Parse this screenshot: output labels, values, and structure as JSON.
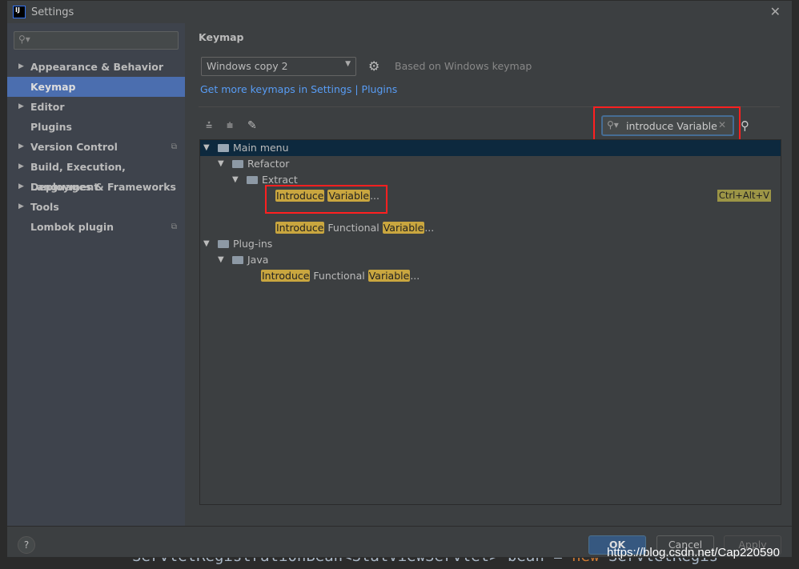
{
  "background_code": {
    "text": "ServletRegistrationBean<StatViewServlet> bean = ",
    "keyword": "new",
    "rest": " ServletRegis"
  },
  "window": {
    "title": "Settings",
    "logo": "IJ",
    "close_icon": "close-icon"
  },
  "sidebar": {
    "search_placeholder": "",
    "items": [
      {
        "label": "Appearance & Behavior",
        "expandable": true
      },
      {
        "label": "Keymap",
        "selected": true
      },
      {
        "label": "Editor",
        "expandable": true
      },
      {
        "label": "Plugins"
      },
      {
        "label": "Version Control",
        "expandable": true,
        "project_icon": true
      },
      {
        "label": "Build, Execution, Deployment",
        "expandable": true
      },
      {
        "label": "Languages & Frameworks",
        "expandable": true
      },
      {
        "label": "Tools",
        "expandable": true
      },
      {
        "label": "Lombok plugin",
        "project_icon": true
      }
    ]
  },
  "main": {
    "heading": "Keymap",
    "keymap_select": "Windows copy 2",
    "based_on": "Based on Windows keymap",
    "link_text": "Get more keymaps in Settings | Plugins",
    "search_value": "introduce Variable",
    "tree": {
      "main_menu": "Main menu",
      "refactor": "Refactor",
      "extract": "Extract",
      "item1": {
        "w1": "Introduce",
        "w2": "Variable",
        "suffix": "...",
        "shortcut": "Ctrl+Alt+V"
      },
      "item2": {
        "w1": "Introduce",
        "mid": " Functional ",
        "w2": "Variable",
        "suffix": "..."
      },
      "plugins": "Plug-ins",
      "java": "Java",
      "item3": {
        "w1": "Introduce",
        "mid": " Functional ",
        "w2": "Variable",
        "suffix": "..."
      }
    }
  },
  "footer": {
    "help": "?",
    "ok": "OK",
    "cancel": "Cancel",
    "apply": "Apply"
  },
  "watermark": "https://blog.csdn.net/Cap220590",
  "colors": {
    "accent": "#4b6eaf",
    "highlight": "#c9a63f",
    "annotation": "#ff2020"
  }
}
